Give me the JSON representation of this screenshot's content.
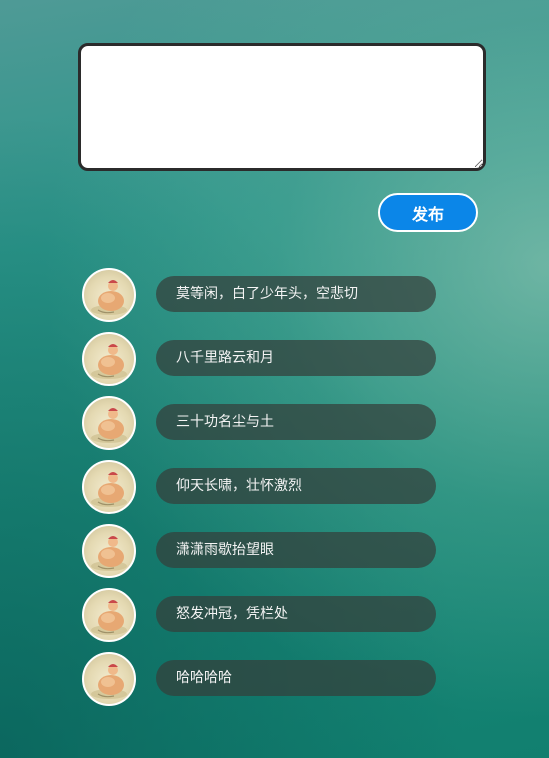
{
  "composer": {
    "value": "",
    "placeholder": ""
  },
  "publish_button": {
    "label": "发布",
    "color": "#0b86e8"
  },
  "posts": [
    {
      "text": "莫等闲，白了少年头，空悲切",
      "avatar": "avatar-image"
    },
    {
      "text": "八千里路云和月",
      "avatar": "avatar-image"
    },
    {
      "text": "三十功名尘与土",
      "avatar": "avatar-image"
    },
    {
      "text": "仰天长啸，壮怀激烈",
      "avatar": "avatar-image"
    },
    {
      "text": "潇潇雨歇抬望眼",
      "avatar": "avatar-image"
    },
    {
      "text": "怒发冲冠，凭栏处",
      "avatar": "avatar-image"
    },
    {
      "text": "哈哈哈哈",
      "avatar": "avatar-image"
    }
  ]
}
